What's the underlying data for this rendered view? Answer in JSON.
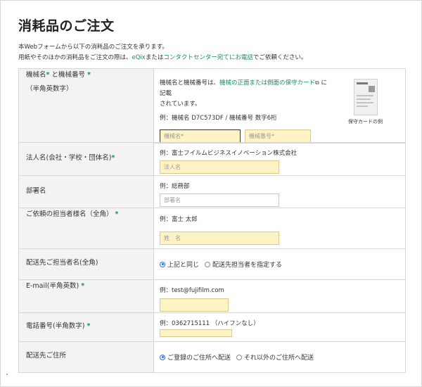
{
  "page": {
    "title": "消耗品のご注文",
    "intro_line1": "本Webフォームから以下の消耗品のご注文を承ります。",
    "intro_line2_a": "用紙やそのほかの消耗品をご注文の際は、",
    "intro_line2_link1": "eQix",
    "intro_line2_b": "または",
    "intro_line2_link2": "コンタクトセンター宛てにお電話",
    "intro_line2_c": "でご依頼ください。"
  },
  "machine": {
    "label_a": "機械名",
    "label_b": " と機械番号 ",
    "label_sub": "（半角英数字）",
    "req": "*",
    "desc_a": "機械名と機械番号は、",
    "desc_link": "機械の正面または側面の保守カード",
    "desc_b": " に記載",
    "desc_c": "されています。",
    "example": "例：機械名 D7C573DF / 機械番号 数字6桁",
    "name_placeholder": "機械名*",
    "number_placeholder": "機械番号*",
    "card_caption": "保守カードの例",
    "ext_icon": "external-link-icon"
  },
  "fields": {
    "corp": {
      "label": "法人名(会社・学校・団体名)",
      "req": "*",
      "example": "例：富士フイルムビジネスイノベーション株式会社",
      "placeholder": "法人名"
    },
    "dept": {
      "label": "部署名",
      "example": "例：総務部",
      "placeholder": "部署名"
    },
    "person": {
      "label": "ご依頼の担当者様名（全角）",
      "req": "*",
      "example": "例：富士 太郎",
      "placeholder": "姓　名"
    },
    "delivery_person": {
      "label": "配送先ご担当者名(全角)",
      "option1": "上記と同じ",
      "option2": "配送先担当者を指定する",
      "selected": "上記と同じ"
    },
    "email": {
      "label": "E-mail(半角英数)",
      "req": "*",
      "example": "例：test@fujifilm.com",
      "value": ""
    },
    "phone": {
      "label": "電話番号(半角数字)",
      "req": "*",
      "example": "例：0362715111 （ハイフンなし）",
      "value": ""
    },
    "address": {
      "label": "配送先ご住所",
      "option1": "ご登録のご住所へ配送",
      "option2": "それ以外のご住所へ配送",
      "selected": "ご登録のご住所へ配送"
    }
  },
  "colors": {
    "accent": "#1a8f5c",
    "field_bg": "#fdf3c4",
    "label_bg": "#f3f3f3"
  }
}
